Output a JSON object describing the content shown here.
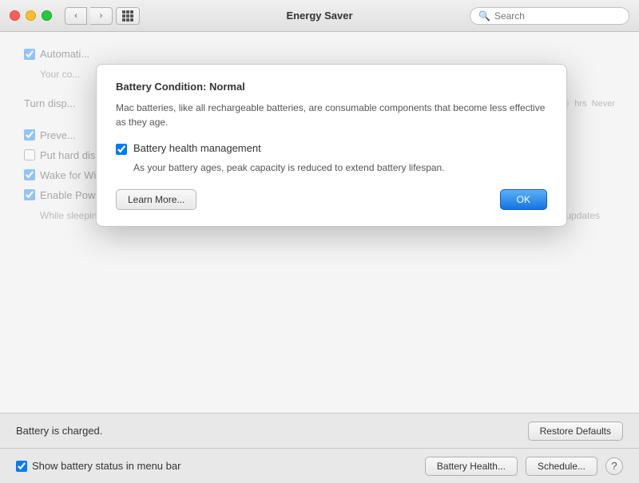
{
  "titlebar": {
    "title": "Energy Saver",
    "search_placeholder": "Search",
    "back_label": "‹",
    "forward_label": "›"
  },
  "main": {
    "row1_label": "Automati...",
    "row1_sub": "Your co...",
    "slider_label": "Turn disp...",
    "slider_left": "",
    "slider_right_hrs": "hrs",
    "slider_right_never": "Never",
    "check_prevent_label": "Preve...",
    "check_harddisk_label": "Put hard disks to sleep when possible",
    "check_wifi_label": "Wake for Wi-Fi network access",
    "check_powernap_label": "Enable Power Nap while plugged into a power adapter",
    "powernap_sub": "While sleeping, your Mac can back up using Time Machine and periodically check for new email, calendar, and other iCloud updates"
  },
  "bottom2": {
    "battery_status": "Battery is charged.",
    "restore_btn": "Restore Defaults"
  },
  "bottom": {
    "show_battery_label": "Show battery status in menu bar",
    "battery_health_btn": "Battery Health...",
    "schedule_btn": "Schedule...",
    "help_btn": "?"
  },
  "popover": {
    "title_prefix": "Battery Condition: ",
    "title_value": "Normal",
    "description": "Mac batteries, like all rechargeable batteries, are consumable components that become less effective as they age.",
    "checkbox_label": "Battery health management",
    "checkbox_desc": "As your battery ages, peak capacity is reduced to extend battery lifespan.",
    "learn_more_btn": "Learn More...",
    "ok_btn": "OK"
  }
}
